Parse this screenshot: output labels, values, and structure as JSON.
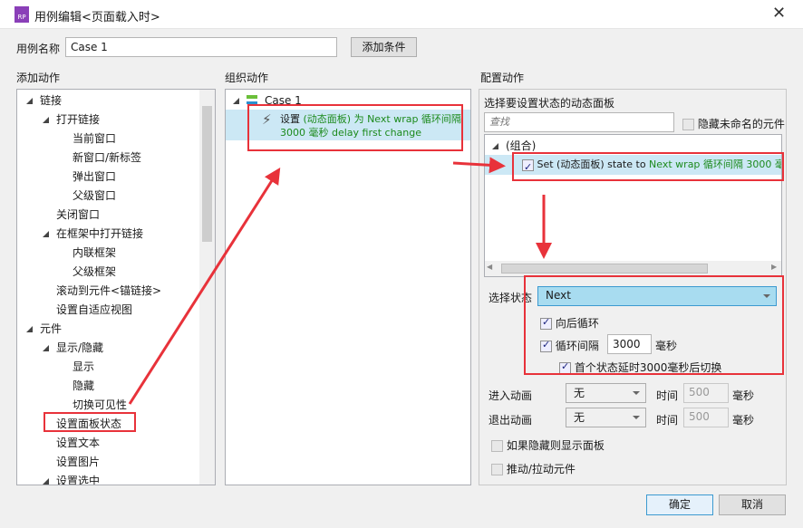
{
  "window": {
    "title": "用例编辑<页面载入时>",
    "logo": "RP",
    "close": "✕"
  },
  "case_name": {
    "label": "用例名称",
    "value": "Case 1",
    "add_condition": "添加条件"
  },
  "add_actions": {
    "header": "添加动作",
    "items": [
      {
        "label": "链接",
        "level": 0,
        "expand": true
      },
      {
        "label": "打开链接",
        "level": 1,
        "expand": true
      },
      {
        "label": "当前窗口",
        "level": 2
      },
      {
        "label": "新窗口/新标签",
        "level": 2
      },
      {
        "label": "弹出窗口",
        "level": 2
      },
      {
        "label": "父级窗口",
        "level": 2
      },
      {
        "label": "关闭窗口",
        "level": 1
      },
      {
        "label": "在框架中打开链接",
        "level": 1,
        "expand": true
      },
      {
        "label": "内联框架",
        "level": 2
      },
      {
        "label": "父级框架",
        "level": 2
      },
      {
        "label": "滚动到元件<锚链接>",
        "level": 1
      },
      {
        "label": "设置自适应视图",
        "level": 1
      },
      {
        "label": "元件",
        "level": 0,
        "expand": true
      },
      {
        "label": "显示/隐藏",
        "level": 1,
        "expand": true
      },
      {
        "label": "显示",
        "level": 2
      },
      {
        "label": "隐藏",
        "level": 2
      },
      {
        "label": "切换可见性",
        "level": 2
      },
      {
        "label": "设置面板状态",
        "level": 1,
        "highlight": true
      },
      {
        "label": "设置文本",
        "level": 1
      },
      {
        "label": "设置图片",
        "level": 1
      },
      {
        "label": "设置选中",
        "level": 1,
        "expand": true
      }
    ]
  },
  "organize": {
    "header": "组织动作",
    "case": "Case 1",
    "action_prefix": "设置",
    "action_line1": "(动态面板) 为 Next wrap 循环间隔",
    "action_line2": "3000 毫秒 delay first change"
  },
  "config": {
    "header": "配置动作",
    "panel_label": "选择要设置状态的动态面板",
    "search_placeholder": "查找",
    "hide_unnamed": "隐藏未命名的元件",
    "group": "(组合)",
    "row_black": "Set (动态面板) state to ",
    "row_green": "Next wrap 循环间隔 3000 毫秒",
    "state_label": "选择状态",
    "state_value": "Next",
    "wrap": "向后循环",
    "interval_label": "循环间隔",
    "interval_value": "3000",
    "ms": "毫秒",
    "first_delay": "首个状态延时3000毫秒后切换",
    "enter_anim": "进入动画",
    "exit_anim": "退出动画",
    "anim_value": "无",
    "time": "时间",
    "time_value": "500",
    "show_if_hidden": "如果隐藏则显示面板",
    "push_pull": "推动/拉动元件"
  },
  "buttons": {
    "ok": "确定",
    "cancel": "取消"
  },
  "colors": {
    "annotation": "#e8323a",
    "selection": "#cce8f5",
    "action_text": "#1c8a1c"
  }
}
